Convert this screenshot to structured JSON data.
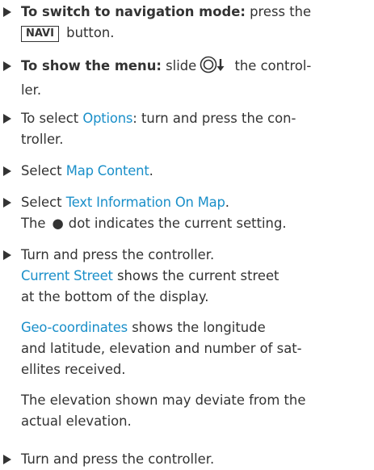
{
  "steps": [
    {
      "bold": "To switch to navigation mode:",
      "pre": " press the",
      "key": "NAVI",
      "post": " button."
    },
    {
      "bold": "To show the menu:",
      "pre": " slide",
      "icon": "controller-slide-down-icon",
      "post": " the control-",
      "line2": "ler."
    },
    {
      "pre": "To select ",
      "hl": "Options",
      "post": ": turn and press the con-",
      "line2": "troller."
    },
    {
      "pre": "Select ",
      "hl": "Map Content",
      "post": "."
    },
    {
      "pre": "Select ",
      "hl": "Text Information On Map",
      "post": ".",
      "line2_pre": "The",
      "dot": "●",
      "line2_post": "dot indicates the current setting."
    },
    {
      "text": "Turn and press the controller.",
      "p1_hl": "Current Street",
      "p1_l1": " shows the current street",
      "p1_l2": "at the bottom of the display.",
      "p2_hl": "Geo-coordinates",
      "p2_l1": " shows the longitude",
      "p2_l2": "and latitude, elevation and number of sat-",
      "p2_l3": "ellites received.",
      "p3_l1": "The elevation shown may deviate from the",
      "p3_l2": "actual elevation."
    },
    {
      "text": "Turn and press the controller."
    }
  ]
}
